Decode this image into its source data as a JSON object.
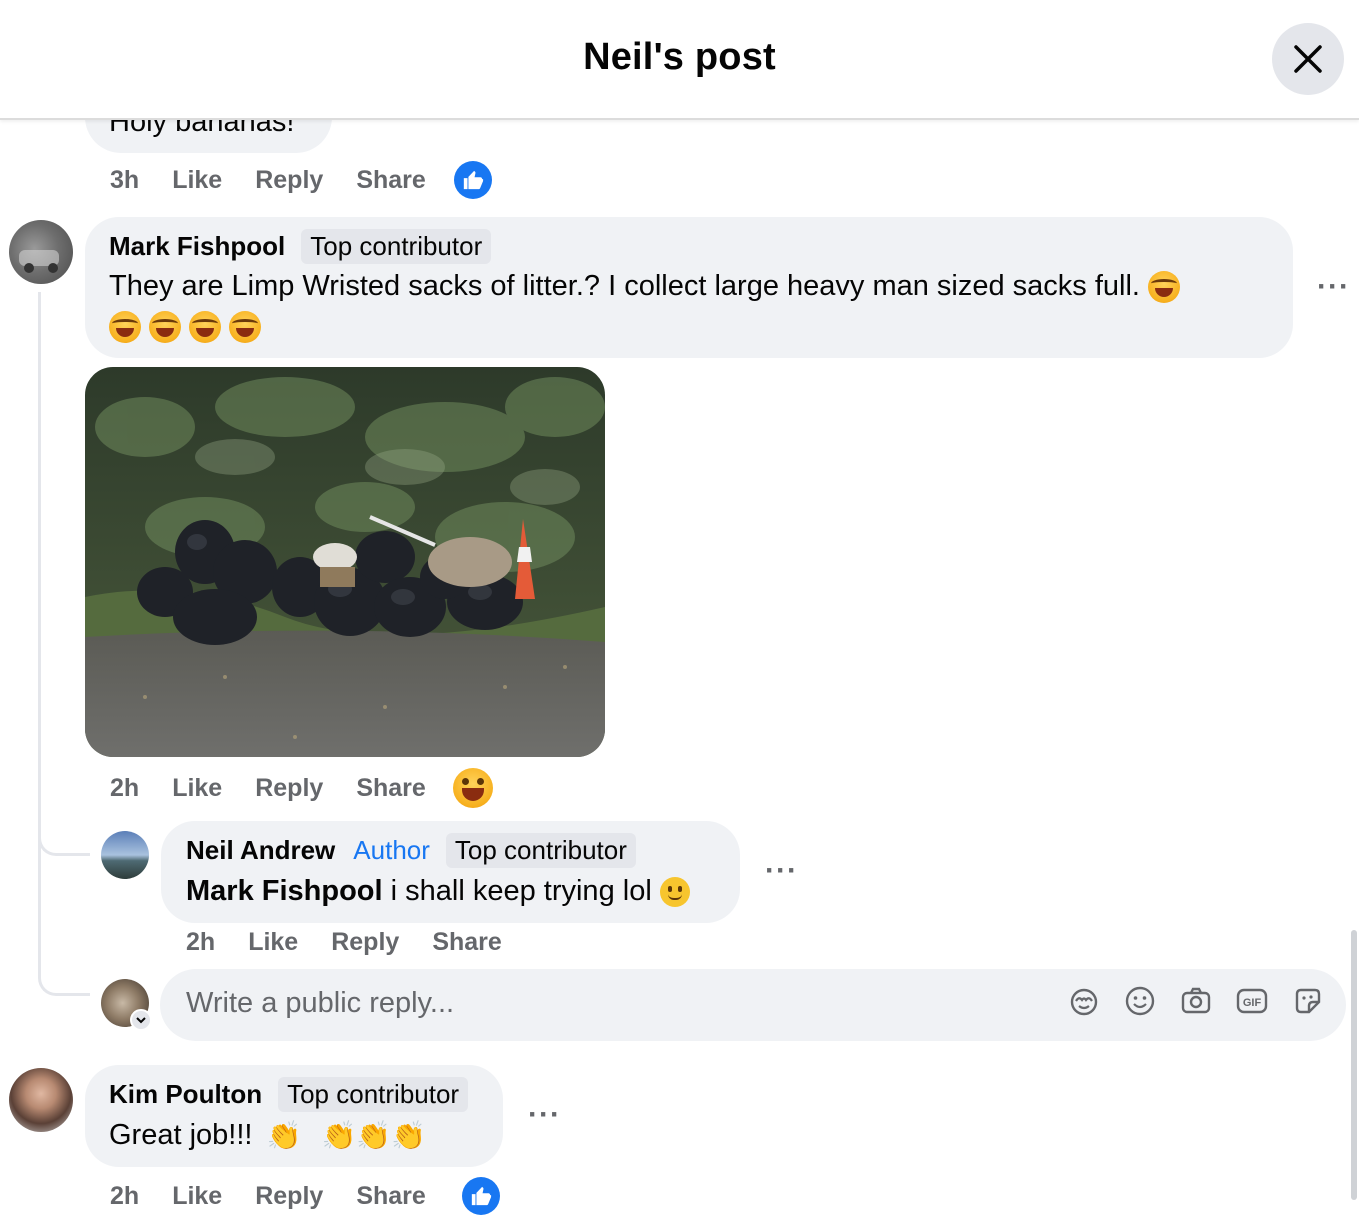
{
  "header": {
    "title": "Neil's post",
    "close_label": "Close"
  },
  "prev_comment": {
    "text_partial": "Holy bananas!",
    "time": "3h",
    "like": "Like",
    "reply": "Reply",
    "share": "Share",
    "reaction": "like"
  },
  "comments": [
    {
      "name": "Mark Fishpool",
      "badge": "Top contributor",
      "text": "They are Limp Wristed sacks of litter.? I collect large heavy man sized sacks full.",
      "time": "2h",
      "like": "Like",
      "reply": "Reply",
      "share": "Share",
      "reaction": "haha",
      "has_photo": true
    },
    {
      "name": "Neil Andrew",
      "author_badge": "Author",
      "badge": "Top contributor",
      "mention": "Mark Fishpool",
      "text": " i shall keep trying lol",
      "time": "2h",
      "like": "Like",
      "reply": "Reply",
      "share": "Share"
    },
    {
      "name": "Kim Poulton",
      "badge": "Top contributor",
      "text": "Great job!!!",
      "time": "2h",
      "like": "Like",
      "reply": "Reply",
      "share": "Share",
      "reaction": "like"
    }
  ],
  "reply_box": {
    "placeholder": "Write a public reply...",
    "icons": [
      "avatar-sticker-icon",
      "emoji-icon",
      "camera-icon",
      "gif-icon",
      "sticker-icon"
    ]
  },
  "colors": {
    "accent": "#1877f2",
    "bubble": "#f0f2f5",
    "muted": "#65676b"
  }
}
